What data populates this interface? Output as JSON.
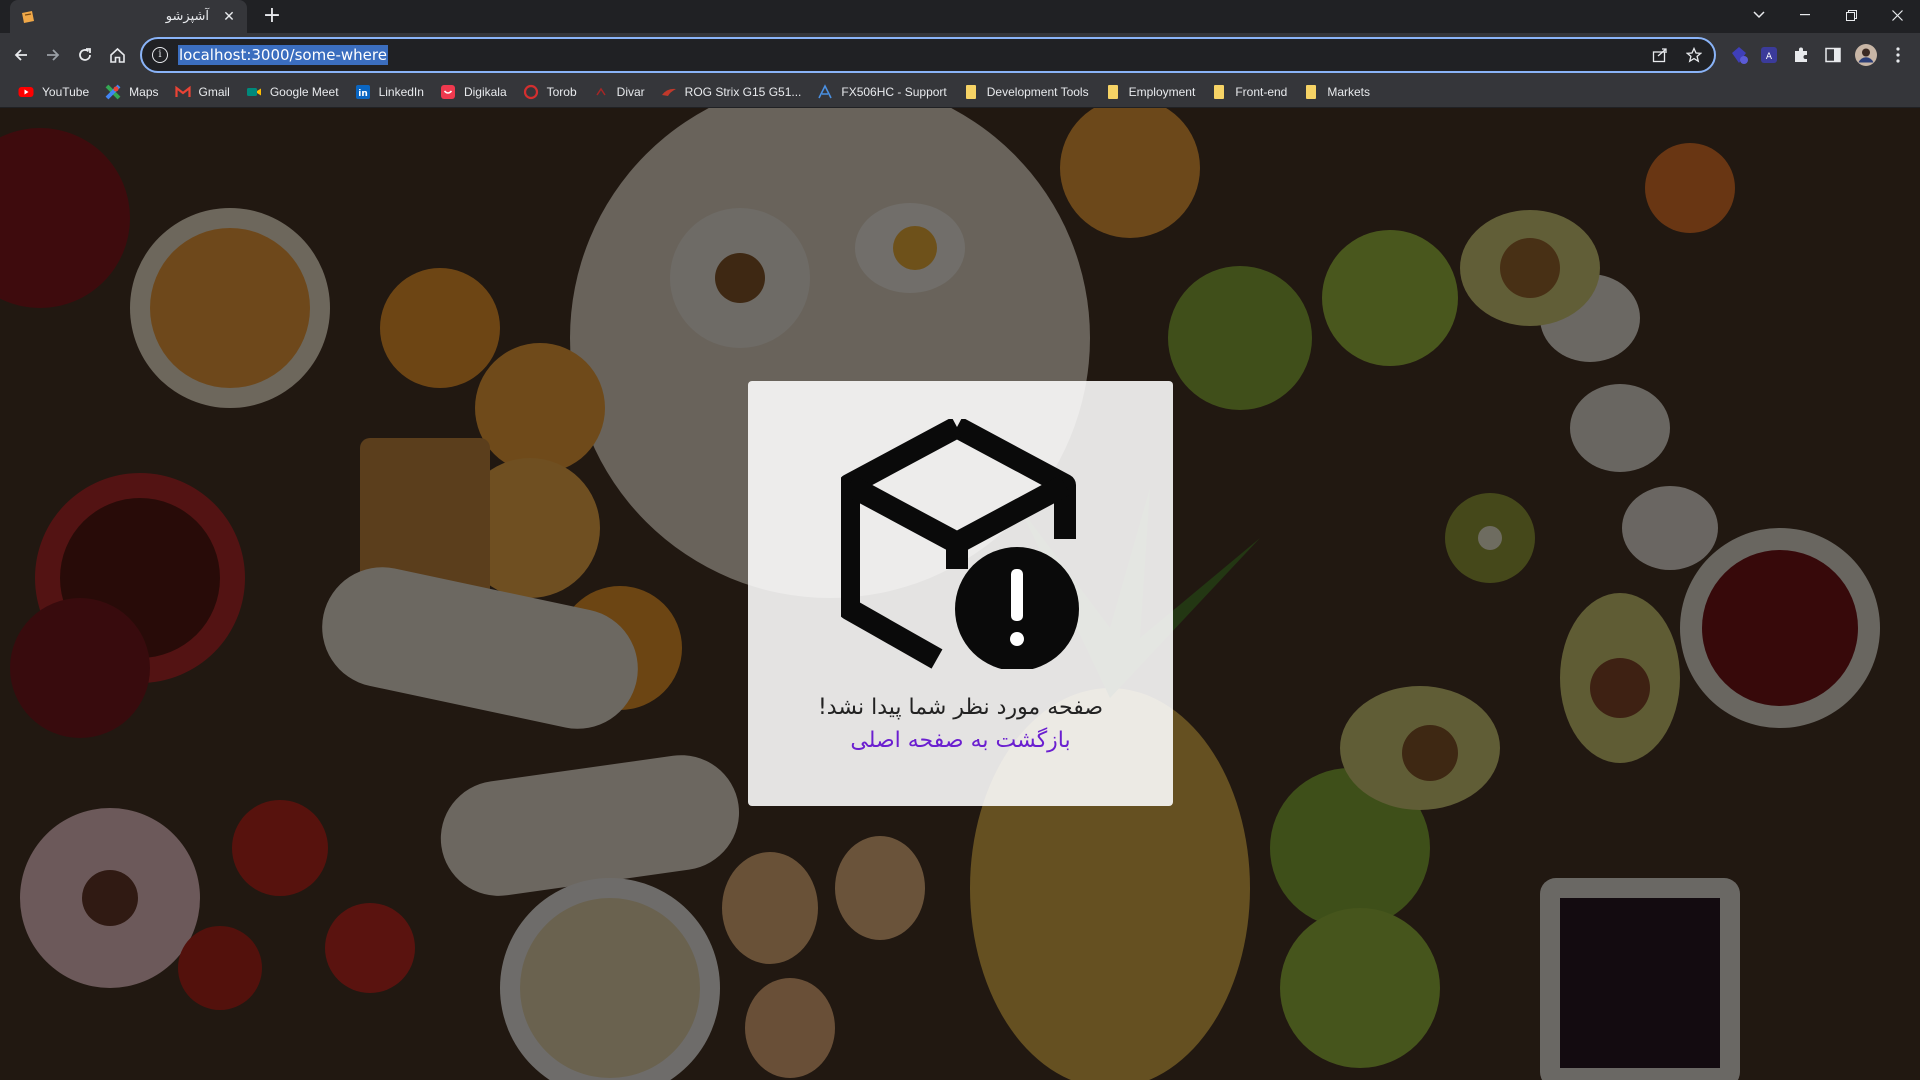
{
  "browser": {
    "tab": {
      "title": "آشپزشو"
    },
    "address": {
      "url": "localhost:3000/some-where"
    }
  },
  "bookmarks": [
    {
      "label": "YouTube",
      "icon": "youtube-icon",
      "color": "#ff0000"
    },
    {
      "label": "Maps",
      "icon": "maps-icon",
      "color": "#34a853"
    },
    {
      "label": "Gmail",
      "icon": "gmail-icon",
      "color": "#ea4335"
    },
    {
      "label": "Google Meet",
      "icon": "google-meet-icon",
      "color": "#00897b"
    },
    {
      "label": "LinkedIn",
      "icon": "linkedin-icon",
      "color": "#0a66c2"
    },
    {
      "label": "Digikala",
      "icon": "digikala-icon",
      "color": "#ef394e"
    },
    {
      "label": "Torob",
      "icon": "torob-icon",
      "color": "#d32f2f"
    },
    {
      "label": "Divar",
      "icon": "divar-icon",
      "color": "#a62626"
    },
    {
      "label": "ROG Strix G15 G51...",
      "icon": "rog-icon",
      "color": "#c0392b"
    },
    {
      "label": "FX506HC - Support",
      "icon": "asus-icon",
      "color": "#4a90e2"
    },
    {
      "label": "Development Tools",
      "icon": "folder-icon",
      "color": "#f6d365"
    },
    {
      "label": "Employment",
      "icon": "folder-icon",
      "color": "#f6d365"
    },
    {
      "label": "Front-end",
      "icon": "folder-icon",
      "color": "#f6d365"
    },
    {
      "label": "Markets",
      "icon": "folder-icon",
      "color": "#f6d365"
    }
  ],
  "not_found": {
    "message": "صفحه مورد نظر شما پیدا نشد!",
    "back_link": "بازگشت به صفحه اصلی",
    "icon": "box-warning-icon"
  },
  "colors": {
    "accent": "#8ab4f8",
    "link": "#6b1fd0"
  }
}
